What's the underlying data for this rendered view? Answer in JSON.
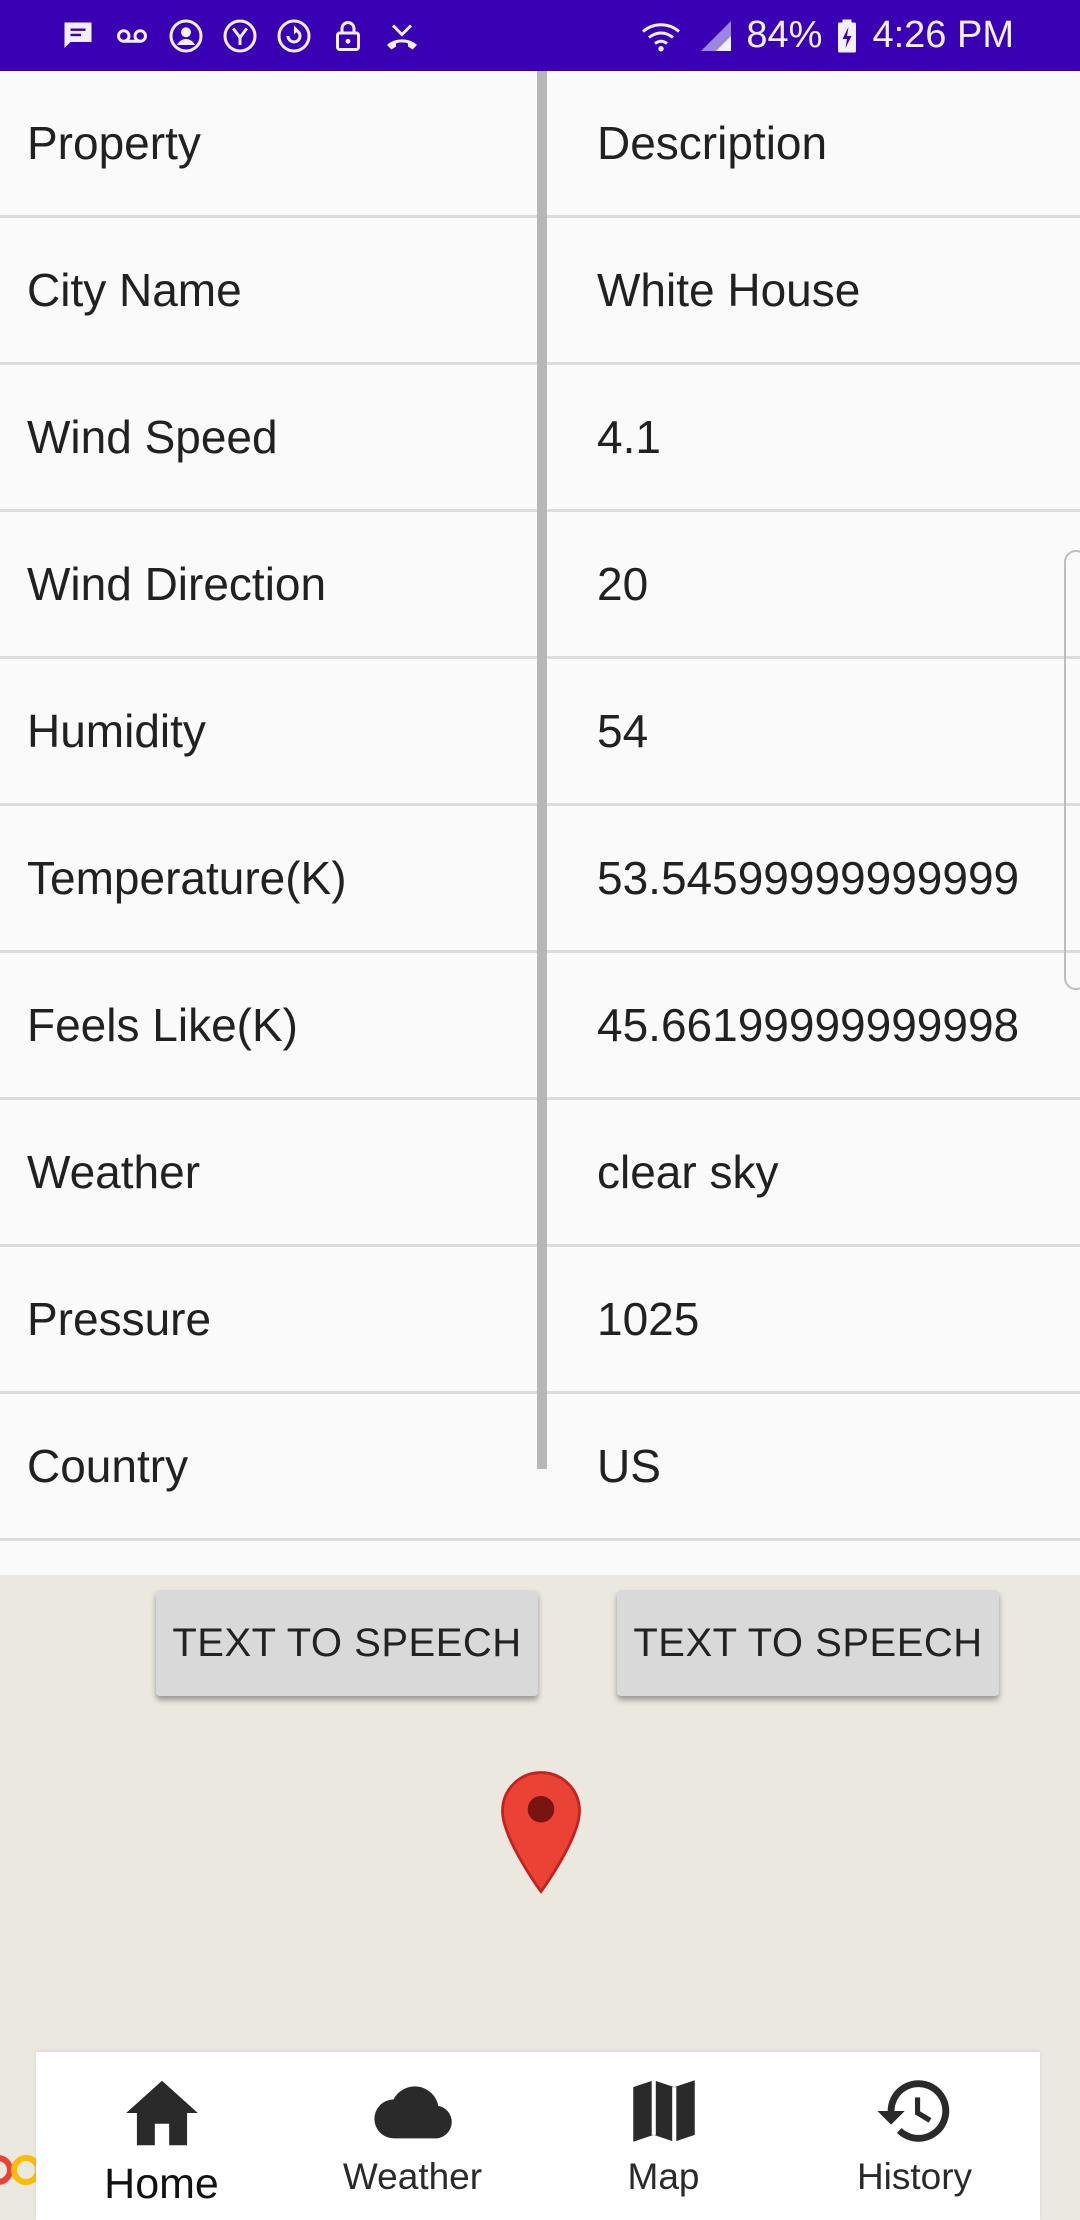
{
  "status_bar": {
    "battery": "84%",
    "time": "4:26 PM",
    "left_icons": [
      "message-icon",
      "voicemail-icon",
      "account-icon",
      "yahoo-icon",
      "sync-icon",
      "lock-icon",
      "missed-call-icon"
    ],
    "right_icons": [
      "wifi-icon",
      "signal-icon",
      "battery-icon"
    ]
  },
  "table": {
    "header": {
      "property": "Property",
      "description": "Description"
    },
    "rows": [
      {
        "property": "City Name",
        "description": "White House"
      },
      {
        "property": "Wind Speed",
        "description": "4.1"
      },
      {
        "property": "Wind Direction",
        "description": "20"
      },
      {
        "property": "Humidity",
        "description": "54"
      },
      {
        "property": "Temperature(K)",
        "description": "53.54599999999999"
      },
      {
        "property": "Feels Like(K)",
        "description": "45.66199999999998"
      },
      {
        "property": "Weather",
        "description": "clear sky"
      },
      {
        "property": "Pressure",
        "description": "1025"
      },
      {
        "property": "Country",
        "description": "US"
      }
    ]
  },
  "buttons": {
    "tts_property": "TEXT TO SPEECH",
    "tts_description": "TEXT TO SPEECH"
  },
  "map": {
    "marker_icon": "map-pin-icon"
  },
  "bottom_nav": {
    "active": "Home",
    "items": [
      {
        "label": "Home",
        "icon": "home-icon"
      },
      {
        "label": "Weather",
        "icon": "cloud-icon"
      },
      {
        "label": "Map",
        "icon": "map-icon"
      },
      {
        "label": "History",
        "icon": "history-icon"
      }
    ]
  },
  "colors": {
    "status_bar": "#3a00b4",
    "pin": "#ea4335",
    "map_bg": "#ebe8df",
    "button_bg": "#d9d9d9"
  }
}
